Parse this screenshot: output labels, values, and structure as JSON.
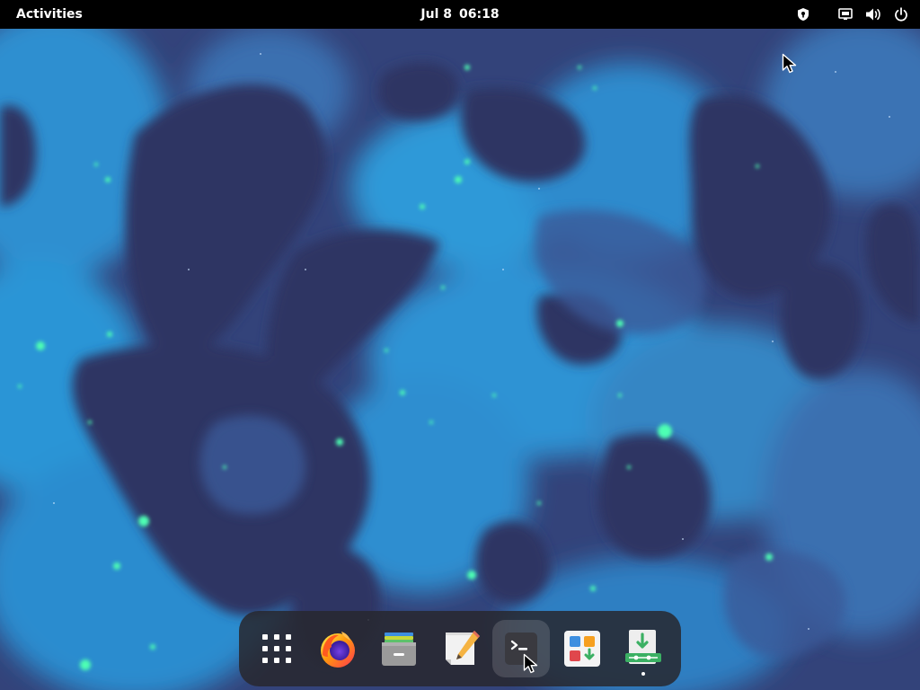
{
  "top_bar": {
    "activities_label": "Activities",
    "clock_date": "Jul 8",
    "clock_time": "06:18",
    "tray_icons": [
      "privacy-shield-icon",
      "network-wired-icon",
      "volume-icon",
      "power-icon"
    ]
  },
  "dock": {
    "items": [
      {
        "name": "show-apps",
        "icon": "app-grid-icon"
      },
      {
        "name": "firefox",
        "icon": "firefox-icon"
      },
      {
        "name": "files",
        "icon": "files-icon"
      },
      {
        "name": "text-editor",
        "icon": "text-editor-icon"
      },
      {
        "name": "terminal",
        "icon": "terminal-icon",
        "hovered": true
      },
      {
        "name": "software",
        "icon": "software-icon"
      },
      {
        "name": "installer",
        "icon": "installer-icon",
        "running": true
      }
    ]
  },
  "colors": {
    "top_bar_bg": "#000000",
    "dock_bg": "#28282e",
    "wallpaper_dark": "#2f3762",
    "wallpaper_mid": "#3e73b4",
    "wallpaper_bright": "#2fa6e0",
    "wallpaper_glow": "#4dffb3"
  }
}
